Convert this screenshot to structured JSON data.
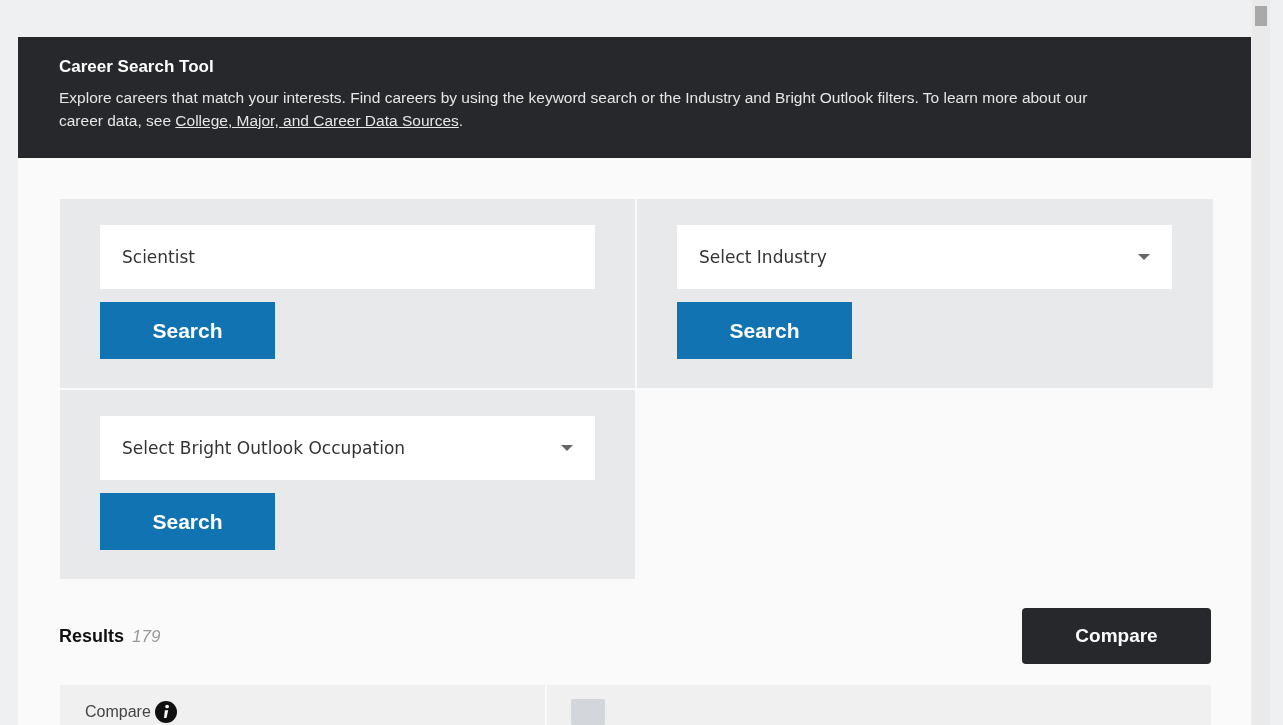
{
  "header": {
    "title": "Career Search Tool",
    "description": {
      "before": "Explore careers that match your interests. Find careers by using the keyword search or the Industry and Bright Outlook filters. To learn more about our career data, see ",
      "link": "College, Major, and Career Data Sources",
      "after": "."
    }
  },
  "filters": [
    {
      "kind": "text",
      "value": "Scientist",
      "button": "Search"
    },
    {
      "kind": "select",
      "value": "Select Industry",
      "button": "Search"
    },
    {
      "kind": "select",
      "value": "Select Bright Outlook Occupation",
      "button": "Search"
    }
  ],
  "results": {
    "label": "Results",
    "count": "179",
    "compare_button": "Compare"
  },
  "table": {
    "columns": [
      {
        "label": "Compare"
      }
    ],
    "select_all": {
      "checked": false
    }
  }
}
